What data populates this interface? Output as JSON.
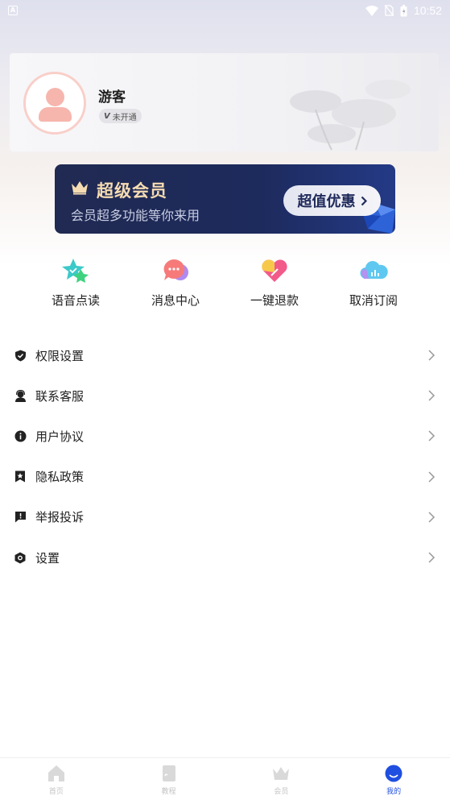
{
  "status_bar": {
    "app_glyph": "A",
    "time": "10:52",
    "icons": [
      "wifi-icon",
      "no-sim-icon",
      "battery-icon"
    ]
  },
  "profile": {
    "name": "游客",
    "vip_status": "未开通",
    "vip_mark": "V"
  },
  "vip_banner": {
    "title": "超级会员",
    "subtitle": "会员超多功能等你来用",
    "button_label": "超值优惠",
    "button_icon": "chevron-right-icon",
    "title_color": "#f6dcb2"
  },
  "quick_actions": [
    {
      "label": "语音点读",
      "icon": "star-voice-icon"
    },
    {
      "label": "消息中心",
      "icon": "chat-bubble-icon"
    },
    {
      "label": "一键退款",
      "icon": "heart-refund-icon"
    },
    {
      "label": "取消订阅",
      "icon": "cloud-chart-icon"
    }
  ],
  "menu": [
    {
      "label": "权限设置",
      "icon": "shield-icon"
    },
    {
      "label": "联系客服",
      "icon": "headset-user-icon"
    },
    {
      "label": "用户协议",
      "icon": "info-icon"
    },
    {
      "label": "隐私政策",
      "icon": "bookmark-star-icon"
    },
    {
      "label": "举报投诉",
      "icon": "report-bubble-icon"
    },
    {
      "label": "设置",
      "icon": "settings-hexagon-icon"
    }
  ],
  "bottom_nav": [
    {
      "label": "首页",
      "icon": "home-icon",
      "active": false
    },
    {
      "label": "教程",
      "icon": "book-icon",
      "active": false
    },
    {
      "label": "会员",
      "icon": "crown-icon",
      "active": false
    },
    {
      "label": "我的",
      "icon": "profile-face-icon",
      "active": true
    }
  ],
  "colors": {
    "accent": "#1f4fe0",
    "banner_bg": "#1d2a5c",
    "avatar": "#f6b6ae"
  }
}
